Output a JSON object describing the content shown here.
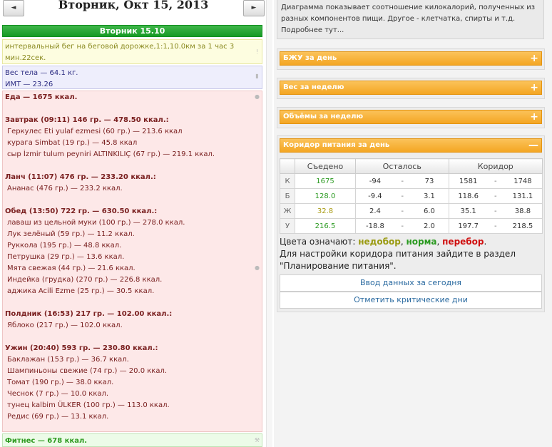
{
  "nav": {
    "prev": "◄",
    "next": "►",
    "date": "Вторник, Окт 15, 2013"
  },
  "day_header": "Вторник 15.10",
  "activity": {
    "line1": "интервальный бег на беговой дорожке,1:1,10.0км за 1 час 3",
    "line2": "мин.22сек."
  },
  "body": {
    "weight": "Вес тела — 64.1 кг.",
    "bmi": "ИМТ — 23.26"
  },
  "food": {
    "total": "Еда — 1675 ккал.",
    "meals": [
      {
        "title": "Завтрак (09:11) 146 гр. — 478.50 ккал.:",
        "items": [
          "Геркулес Eti yulaf ezmesi (60 гр.) — 213.6 ккал",
          "курага Simbat (19 гр.) — 45.8 ккал",
          "сыр İzmir tulum peyniri ALTINKILIÇ (67 гр.) — 219.1 ккал."
        ]
      },
      {
        "title": "Ланч (11:07) 476 гр. — 233.20 ккал.:",
        "items": [
          "Ананас (476 гр.) — 233.2 ккал."
        ]
      },
      {
        "title": "Обед (13:50) 722 гр. — 630.50 ккал.:",
        "items": [
          "лаваш из цельной муки (100 гр.) — 278.0 ккал.",
          "Лук зелёный (59 гр.) — 11.2 ккал.",
          "Руккола (195 гр.) — 48.8 ккал.",
          "Петрушка (29 гр.) — 13.6 ккал.",
          "Мята свежая (44 гр.) — 21.6 ккал.",
          "Индейка (грудка) (270 гр.) — 226.8 ккал.",
          "аджика Acili Ezme (25 гр.) — 30.5 ккал."
        ]
      },
      {
        "title": "Полдник (16:53) 217 гр. — 102.00 ккал.:",
        "items": [
          "Яблоко (217 гр.) — 102.0 ккал."
        ]
      },
      {
        "title": "Ужин (20:40) 593 гр. — 230.80 ккал.:",
        "items": [
          "Баклажан (153 гр.) — 36.7 ккал.",
          "Шампиньоны свежие (74 гр.) — 20.0 ккал.",
          "Томат (190 гр.) — 38.0 ккал.",
          "Чеснок (7 гр.) — 10.0 ккал.",
          "тунец kalbim ÜLKER (100 гр.) — 113.0 ккал.",
          "Редис (69 гр.) — 13.1 ккал."
        ]
      }
    ]
  },
  "fitness": "Фитнес — 678 ккал.",
  "info_text": {
    "line1": "Диаграмма показывает соотношение килокалорий, полученных из",
    "line2": "разных компонентов пищи. Другое - клетчатка, спирты и т.д.",
    "line3": "Подробнее тут..."
  },
  "panels": {
    "bju": {
      "title": "БЖУ за день",
      "sign": "+"
    },
    "weight": {
      "title": "Вес за неделю",
      "sign": "+"
    },
    "volume": {
      "title": "Объёмы за неделю",
      "sign": "+"
    },
    "corridor": {
      "title": "Коридор питания за день",
      "sign": "—"
    }
  },
  "corridor_table": {
    "headers": [
      "Съедено",
      "Осталось",
      "Коридор"
    ],
    "dash": "-",
    "rows": [
      {
        "label": "К",
        "eaten": "1675",
        "rem_min": "-94",
        "rem_max": "73",
        "cor_min": "1581",
        "cor_max": "1748"
      },
      {
        "label": "Б",
        "eaten": "128.0",
        "rem_min": "-9.4",
        "rem_max": "3.1",
        "cor_min": "118.6",
        "cor_max": "131.1"
      },
      {
        "label": "Ж",
        "eaten": "32.8",
        "rem_min": "2.4",
        "rem_max": "6.0",
        "cor_min": "35.1",
        "cor_max": "38.8"
      },
      {
        "label": "У",
        "eaten": "216.5",
        "rem_min": "-18.8",
        "rem_max": "2.0",
        "cor_min": "197.7",
        "cor_max": "218.5"
      }
    ]
  },
  "legend": {
    "prefix": "Цвета означают: ",
    "low": "недобор",
    "sep1": ", ",
    "ok": "норма",
    "sep2": ", ",
    "over": "перебор",
    "end": "."
  },
  "hint": {
    "line1": "Для настройки коридора питания зайдите в раздел",
    "line2": "\"Планирование питания\"."
  },
  "buttons": {
    "enter": "Ввод данных за сегодня",
    "critical": "Отметить критические дни"
  },
  "colors": {
    "green": "#169a24",
    "orange": "#f4a623",
    "ok": "#2a9a20",
    "low": "#9a9a10",
    "over": "#d01010"
  }
}
